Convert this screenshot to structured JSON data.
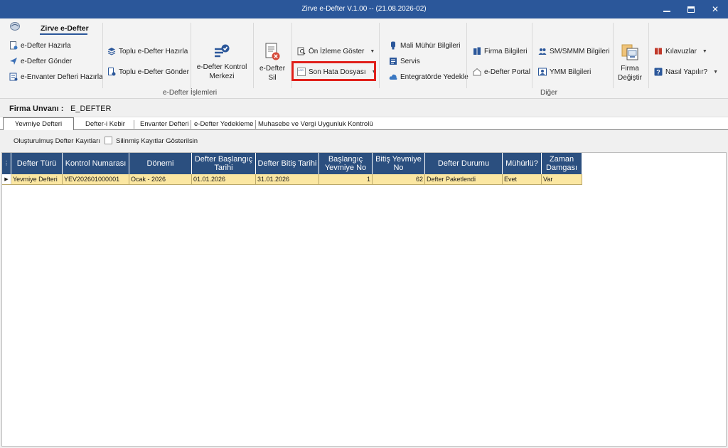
{
  "window": {
    "title": "Zirve e-Defter V.1.00  -- (21.08.2026-02)"
  },
  "ribbon": {
    "tab": "Zirve e-Defter",
    "group1": {
      "hazirla": "e-Defter Hazırla",
      "gonder": "e-Defter Gönder",
      "envanter": "e-Envanter Defteri Hazırla",
      "toplu_hazirla": "Toplu e-Defter Hazırla",
      "toplu_gonder": "Toplu e-Defter Gönder",
      "kontrol_merkezi_l1": "e-Defter Kontrol",
      "kontrol_merkezi_l2": "Merkezi",
      "sil_l1": "e-Defter",
      "sil_l2": "Sil",
      "onizleme": "Ön İzleme Göster",
      "son_hata": "Son Hata Dosyası",
      "label": "e-Defter İşlemleri"
    },
    "group2": {
      "mali_muhur": "Mali Mühür Bilgileri",
      "servis": "Servis",
      "entegrator": "Entegratörde Yedekle",
      "firma_bilgileri": "Firma Bilgileri",
      "edefter_portal": "e-Defter Portal",
      "smmm": "SM/SMMM Bilgileri",
      "ymm": "YMM Bilgileri",
      "firma_degistir_l1": "Firma",
      "firma_degistir_l2": "Değiştir",
      "kilavuzlar": "Kılavuzlar",
      "nasil": "Nasıl Yapılır?",
      "label": "Diğer"
    }
  },
  "firma": {
    "label": "Firma Unvanı :",
    "value": "E_DEFTER"
  },
  "tabs": [
    "Yevmiye Defteri",
    "Defter-i Kebir",
    "Envanter Defteri",
    "e-Defter Yedekleme",
    "Muhasebe ve Vergi Uygunluk Kontrolü"
  ],
  "filter": {
    "label": "Oluşturulmuş Defter Kayıtları",
    "checkbox_label": "Silinmiş Kayıtlar Gösterilsin",
    "checked": false
  },
  "grid": {
    "columns": [
      "Defter Türü",
      "Kontrol Numarası",
      "Dönemi",
      "Defter Başlangıç Tarihi",
      "Defter Bitiş Tarihi",
      "Başlangıç Yevmiye No",
      "Bitiş Yevmiye No",
      "Defter Durumu",
      "Mühürlü?",
      "Zaman Damgası"
    ],
    "rows": [
      {
        "defter_turu": "Yevmiye Defteri",
        "kontrol_no": "YEV202601000001",
        "donemi": "Ocak - 2026",
        "baslangic": "01.01.2026",
        "bitis": "31.01.2026",
        "bas_yevmiye": "1",
        "bit_yevmiye": "62",
        "durum": "Defter Paketlendi",
        "muhurlu": "Evet",
        "zaman_damgasi": "Var"
      }
    ]
  },
  "colors": {
    "titlebar": "#2b579a",
    "grid_header": "#2b4f7f",
    "selected_row": "#fbe7a2",
    "highlight_box": "#e0201b"
  }
}
